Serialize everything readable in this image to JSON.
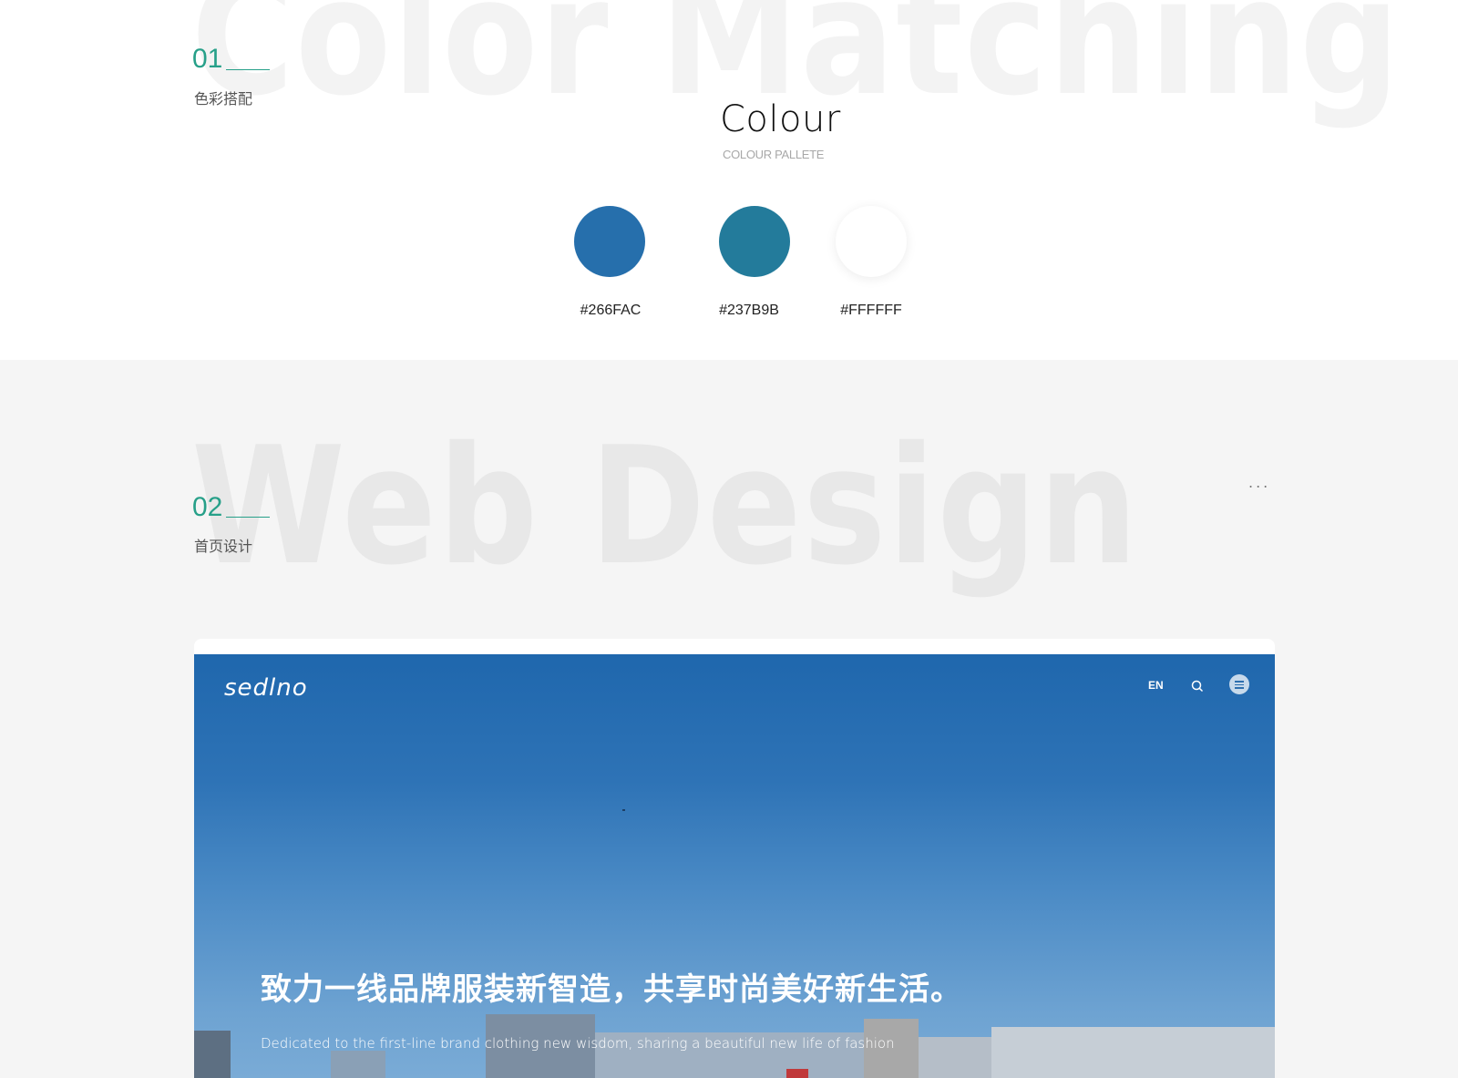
{
  "section1": {
    "bg_word": "Color Matching",
    "number": "01",
    "subtitle": "色彩搭配",
    "colour_title": "Colour",
    "colour_subtitle": "COLOUR PALLETE",
    "swatches": [
      {
        "hex": "#266FAC",
        "label": "#266FAC"
      },
      {
        "hex": "#237B9B",
        "label": "#237B9B"
      },
      {
        "hex": "#FFFFFF",
        "label": "#FFFFFF"
      }
    ]
  },
  "section2": {
    "bg_word": "Web Design",
    "number": "02",
    "subtitle": "首页设计",
    "more": "...",
    "mockup": {
      "logo": "sedlno",
      "nav_lang": "EN",
      "headline": "致力一线品牌服装新智造，共享时尚美好新生活。",
      "tagline": "Dedicated to the first-line brand clothing new wisdom, sharing a beautiful new life of fashion"
    }
  },
  "colors": {
    "accent": "#27a089",
    "hero_top": "#1f67ad",
    "hero_bottom": "#7aabd6"
  }
}
